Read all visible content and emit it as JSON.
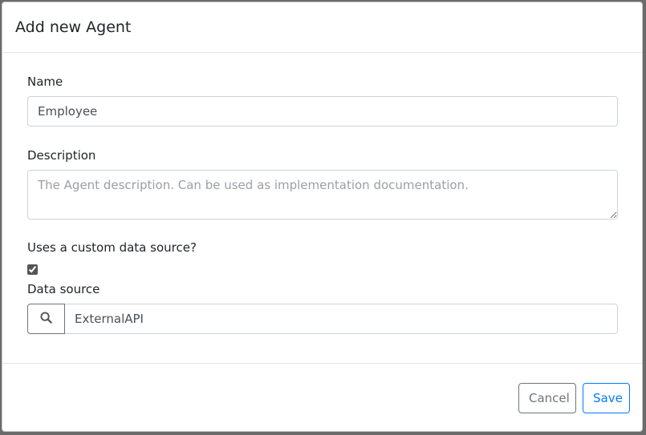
{
  "dialog": {
    "title": "Add new Agent"
  },
  "form": {
    "name": {
      "label": "Name",
      "value": "Employee"
    },
    "description": {
      "label": "Description",
      "placeholder": "The Agent description. Can be used as implementation documentation.",
      "value": ""
    },
    "custom_data_source": {
      "label": "Uses a custom data source?",
      "checked": true
    },
    "data_source": {
      "label": "Data source",
      "value": "ExternalAPI",
      "button_icon": "search-icon"
    }
  },
  "footer": {
    "cancel_label": "Cancel",
    "save_label": "Save"
  },
  "colors": {
    "save_accent": "#007bff",
    "cancel_accent": "#6c757d"
  }
}
